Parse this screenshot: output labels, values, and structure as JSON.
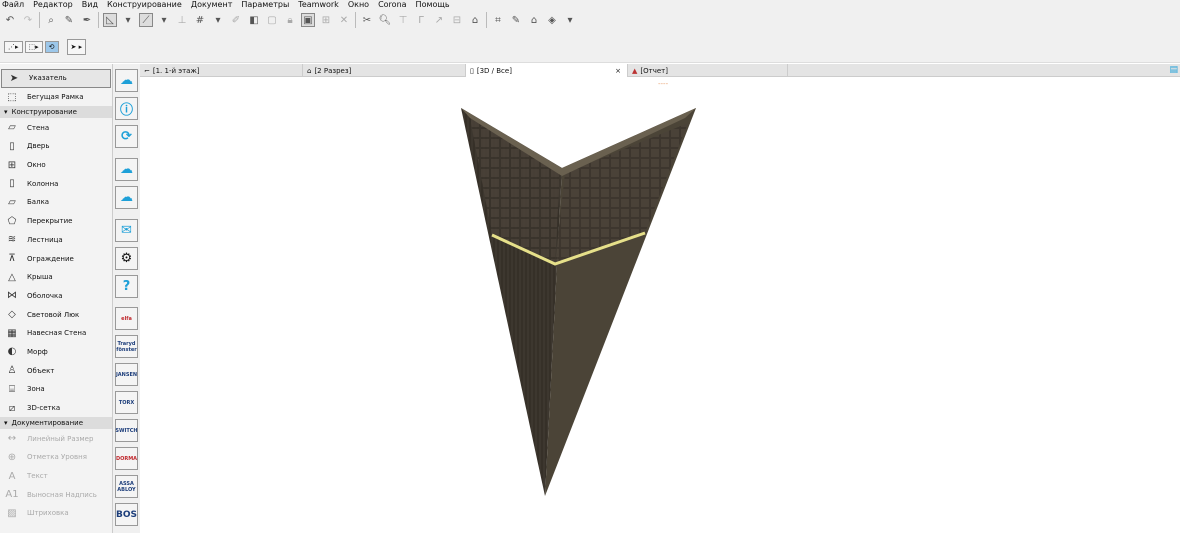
{
  "menu": [
    "Файл",
    "Редактор",
    "Вид",
    "Конструирование",
    "Документ",
    "Параметры",
    "Teamwork",
    "Окно",
    "Corona",
    "Помощь"
  ],
  "toolbox": {
    "top_items": [
      {
        "label": "Указатель",
        "icon": "arrow-pointer-icon"
      },
      {
        "label": "Бегущая Рамка",
        "icon": "marquee-icon"
      }
    ],
    "groups": [
      {
        "label": "Конструирование",
        "items": [
          {
            "label": "Стена",
            "icon": "wall-icon"
          },
          {
            "label": "Дверь",
            "icon": "door-icon"
          },
          {
            "label": "Окно",
            "icon": "window-icon"
          },
          {
            "label": "Колонна",
            "icon": "column-icon"
          },
          {
            "label": "Балка",
            "icon": "beam-icon"
          },
          {
            "label": "Перекрытие",
            "icon": "slab-icon"
          },
          {
            "label": "Лестница",
            "icon": "stair-icon"
          },
          {
            "label": "Ограждение",
            "icon": "railing-icon"
          },
          {
            "label": "Крыша",
            "icon": "roof-icon"
          },
          {
            "label": "Оболочка",
            "icon": "shell-icon"
          },
          {
            "label": "Световой Люк",
            "icon": "skylight-icon"
          },
          {
            "label": "Навесная Стена",
            "icon": "curtain-wall-icon"
          },
          {
            "label": "Морф",
            "icon": "morph-icon"
          },
          {
            "label": "Объект",
            "icon": "object-icon"
          },
          {
            "label": "Зона",
            "icon": "zone-icon"
          },
          {
            "label": "3D-сетка",
            "icon": "mesh-icon"
          }
        ]
      },
      {
        "label": "Документирование",
        "items": [
          {
            "label": "Линейный Размер",
            "icon": "dimension-icon"
          },
          {
            "label": "Отметка Уровня",
            "icon": "level-icon"
          },
          {
            "label": "Текст",
            "icon": "text-icon"
          },
          {
            "label": "Выносная Надпись",
            "icon": "label-icon"
          },
          {
            "label": "Штриховка",
            "icon": "fill-icon"
          }
        ]
      }
    ]
  },
  "palette": [
    "cloud-upload",
    "info",
    "sync",
    "cloud-list",
    "cloud-sync",
    "mail",
    "settings",
    "help",
    "elfa",
    "Traryd fönster",
    "JANSEN",
    "TORX",
    "SWITCH",
    "DORMA",
    "ASSA ABLOY",
    "BOS"
  ],
  "tabs": [
    {
      "label": "[1. 1-й этаж]",
      "icon": "floor-plan-icon"
    },
    {
      "label": "[2 Разрез]",
      "icon": "section-icon"
    },
    {
      "label": "[3D / Все]",
      "icon": "3d-icon",
      "active": true
    },
    {
      "label": "[Отчет]",
      "icon": "report-icon"
    }
  ],
  "tab_close": "×",
  "colors": {
    "accent": "#1ea0d8",
    "gold_line": "#e6e08a",
    "wood_dark": "#3b352d"
  }
}
